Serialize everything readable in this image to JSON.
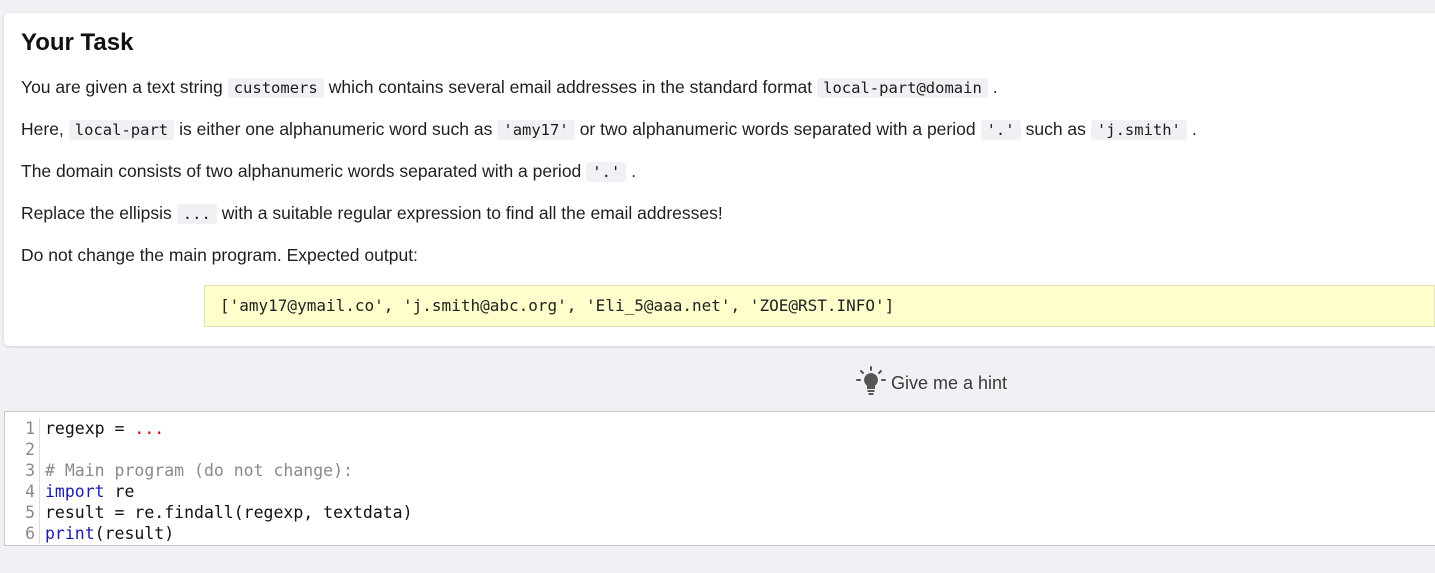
{
  "task": {
    "title": "Your Task",
    "p1": {
      "a": "You are given a text string",
      "c1": "customers",
      "b": "which contains several email addresses in the standard format",
      "c2": "local-part@domain",
      "end": "."
    },
    "p2": {
      "a": "Here,",
      "c1": "local-part",
      "b": "is either one alphanumeric word such as",
      "c2": "'amy17'",
      "c": "or two alphanumeric words separated with a period",
      "c3": "'.'",
      "d": "such as",
      "c4": "'j.smith'",
      "end": "."
    },
    "p3": {
      "a": "The domain consists of two alphanumeric words separated with a period",
      "c1": "'.'",
      "end": "."
    },
    "p4": {
      "a": "Replace the ellipsis",
      "c1": "...",
      "b": "with a suitable regular expression to find all the email addresses!"
    },
    "p5": {
      "a": "Do not change the main program. Expected output:"
    },
    "expected_output": "['amy17@ymail.co', 'j.smith@abc.org', 'Eli_5@aaa.net', 'ZOE@RST.INFO']"
  },
  "hint": {
    "label": "Give me a hint",
    "icon": "lightbulb-icon"
  },
  "editor": {
    "lines": [
      {
        "num": "1",
        "pre": "regexp = ",
        "red": "..."
      },
      {
        "num": "2"
      },
      {
        "num": "3",
        "comment": "# Main program (do not change):"
      },
      {
        "num": "4",
        "kw": "import",
        "rest": " re"
      },
      {
        "num": "5",
        "text": "result = re.findall(regexp, textdata)"
      },
      {
        "num": "6",
        "kw": "print",
        "rest": "(result)"
      }
    ]
  },
  "colors": {
    "background": "#f1f0f5",
    "expected_bg": "#ffffcc",
    "keyword": "#1b1bb0",
    "literal": "#d00000"
  }
}
